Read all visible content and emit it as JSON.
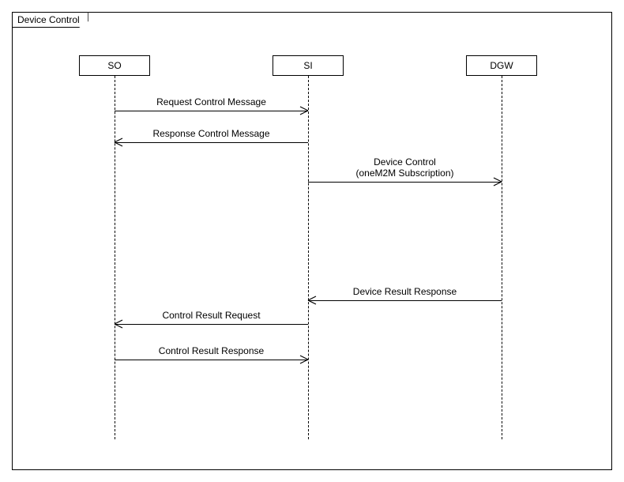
{
  "frame": {
    "title": "Device Control"
  },
  "participants": {
    "so": {
      "label": "SO"
    },
    "si": {
      "label": "SI"
    },
    "dgw": {
      "label": "DGW"
    }
  },
  "messages": {
    "m1": {
      "label": "Request Control Message"
    },
    "m2": {
      "label": "Response Control Message"
    },
    "m3": {
      "label": "Device Control",
      "sublabel": "(oneM2M Subscription)"
    },
    "m4": {
      "label": "Device Result Response"
    },
    "m5": {
      "label": "Control Result Request"
    },
    "m6": {
      "label": "Control Result Response"
    }
  }
}
